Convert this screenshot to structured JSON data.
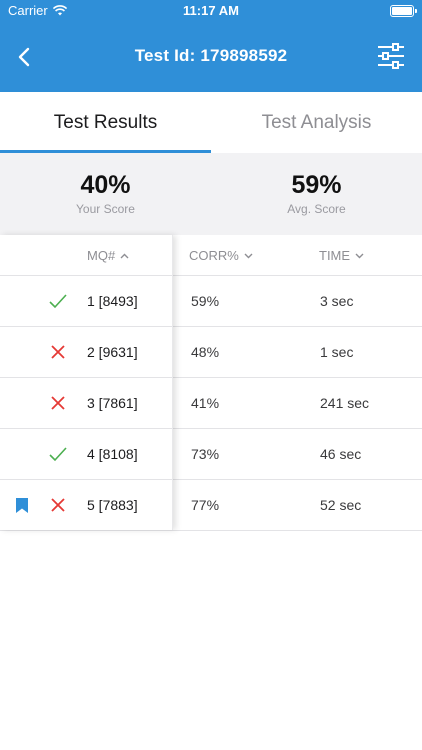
{
  "status_bar": {
    "carrier": "Carrier",
    "time": "11:17 AM"
  },
  "header": {
    "title": "Test Id: 179898592"
  },
  "tabs": [
    {
      "label": "Test Results",
      "active": true
    },
    {
      "label": "Test Analysis",
      "active": false
    }
  ],
  "summary": {
    "your_score": {
      "value": "40%",
      "label": "Your Score"
    },
    "avg_score": {
      "value": "59%",
      "label": "Avg. Score"
    }
  },
  "table": {
    "columns": [
      "MQ#",
      "CORR%",
      "TIME"
    ],
    "rows": [
      {
        "result": "correct",
        "bookmarked": false,
        "mq": "1 [8493]",
        "corr": "59%",
        "time": "3 sec"
      },
      {
        "result": "incorrect",
        "bookmarked": false,
        "mq": "2 [9631]",
        "corr": "48%",
        "time": "1 sec"
      },
      {
        "result": "incorrect",
        "bookmarked": false,
        "mq": "3 [7861]",
        "corr": "41%",
        "time": "241 sec"
      },
      {
        "result": "correct",
        "bookmarked": false,
        "mq": "4 [8108]",
        "corr": "73%",
        "time": "46 sec"
      },
      {
        "result": "incorrect",
        "bookmarked": true,
        "mq": "5 [7883]",
        "corr": "77%",
        "time": "52 sec"
      }
    ]
  },
  "colors": {
    "primary": "#2f8fd8",
    "correct": "#4caf50",
    "incorrect": "#e53935",
    "bookmark": "#2f8fd8"
  }
}
